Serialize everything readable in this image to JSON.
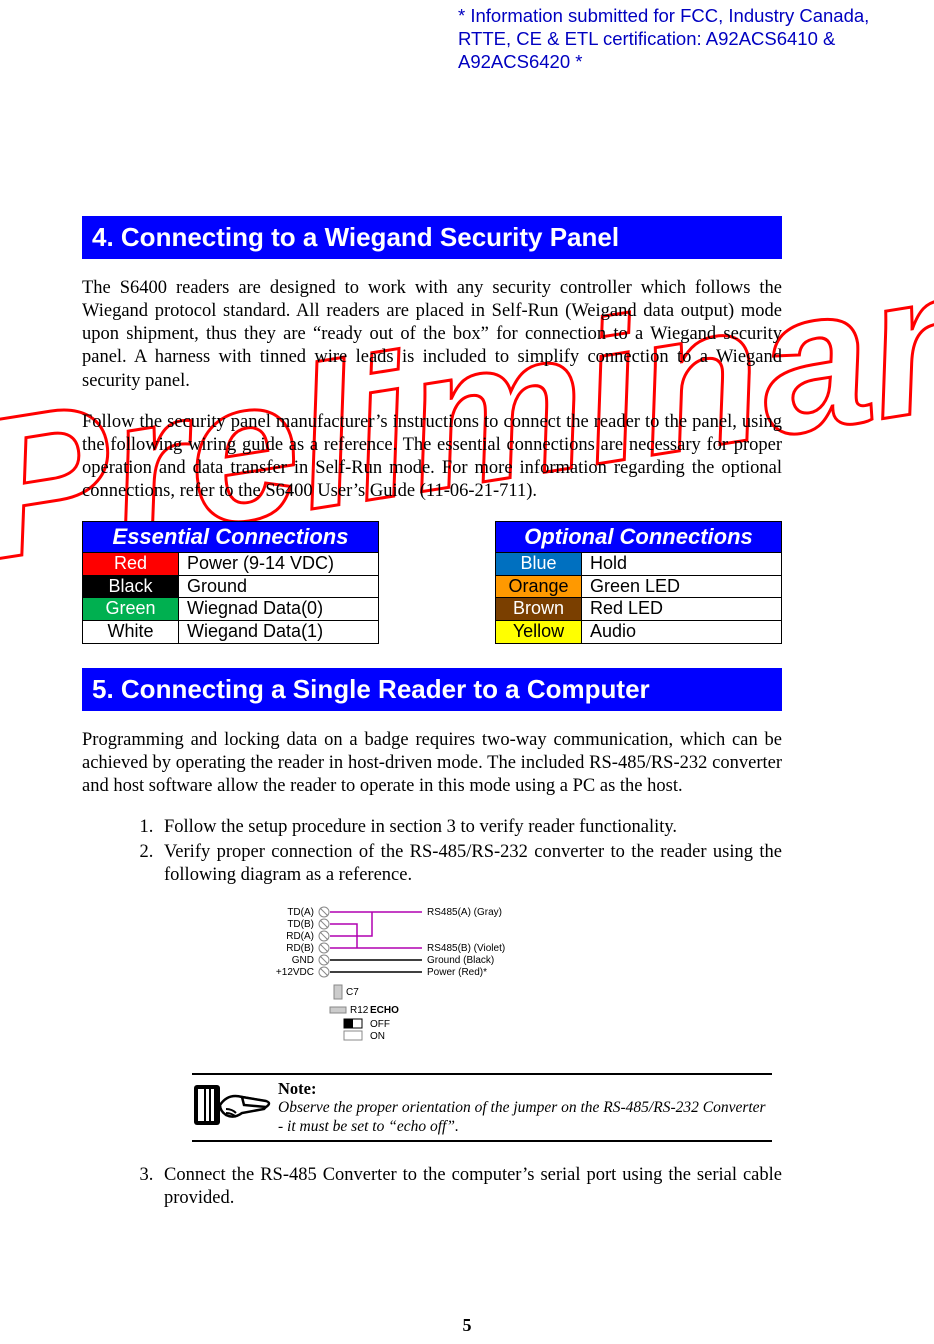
{
  "certification_note": "* Information submitted for FCC, Industry Canada, RTTE, CE & ETL certification: A92ACS6410 & A92ACS6420 *",
  "section4": {
    "title": "4. Connecting to a Wiegand Security Panel",
    "para1": "The S6400 readers are designed to work with any security controller which follows the Wiegand protocol standard.  All readers are placed in Self-Run (Weigand data output) mode upon shipment, thus they are “ready out of the box” for connection to a Wiegand security panel.  A harness with tinned wire leads is included to simplify connection to a Wiegand security panel.",
    "para2": "Follow the security panel manufacturer’s instructions to connect the reader to the panel, using the following wiring guide as a reference.  The essential connections are necessary for proper operation and data transfer in Self-Run mode.  For more information regarding the optional connections, refer to the S6400 User’s Guide (11-06-21-711).",
    "essential": {
      "header": "Essential Connections",
      "rows": [
        {
          "color": "Red",
          "class": "c-red",
          "desc": "Power (9-14 VDC)"
        },
        {
          "color": "Black",
          "class": "c-black",
          "desc": "Ground"
        },
        {
          "color": "Green",
          "class": "c-green",
          "desc": "Wiegnad Data(0)"
        },
        {
          "color": "White",
          "class": "c-white",
          "desc": "Wiegand Data(1)"
        }
      ]
    },
    "optional": {
      "header": "Optional Connections",
      "rows": [
        {
          "color": "Blue",
          "class": "c-blue",
          "desc": "Hold"
        },
        {
          "color": "Orange",
          "class": "c-orange",
          "desc": "Green LED"
        },
        {
          "color": "Brown",
          "class": "c-brown",
          "desc": "Red LED"
        },
        {
          "color": "Yellow",
          "class": "c-yellow",
          "desc": "Audio"
        }
      ]
    }
  },
  "section5": {
    "title": "5. Connecting a Single Reader to a Computer",
    "para1": "Programming and locking data on a badge requires two-way communication, which can be achieved by operating the reader in host-driven mode.  The included RS-485/RS-232 converter and host software allow the reader to operate in this mode using a PC as the host.",
    "steps": {
      "s1": "Follow the setup procedure in section 3 to verify reader functionality.",
      "s2": "Verify proper connection of the RS-485/RS-232 converter to the  reader using the following diagram as a reference.",
      "s3": "Connect the RS-485 Converter to the computer’s serial port using the serial cable provided."
    },
    "diagram": {
      "terminals": [
        "TD(A)",
        "TD(B)",
        "RD(A)",
        "RD(B)",
        "GND",
        "+12VDC"
      ],
      "wires": [
        "RS485(A) (Gray)",
        "RS485(B) (Violet)",
        "Ground (Black)",
        "Power (Red)*"
      ],
      "comp": "C7",
      "res": "R12",
      "switch_label": "ECHO",
      "switch_options": [
        "OFF",
        "ON"
      ]
    },
    "note": {
      "title": "Note:",
      "body": "Observe the proper orientation of the jumper on the RS-485/RS-232 Converter - it must be set to “echo off”."
    }
  },
  "watermark_text": "Preliminary",
  "page_number": "5"
}
